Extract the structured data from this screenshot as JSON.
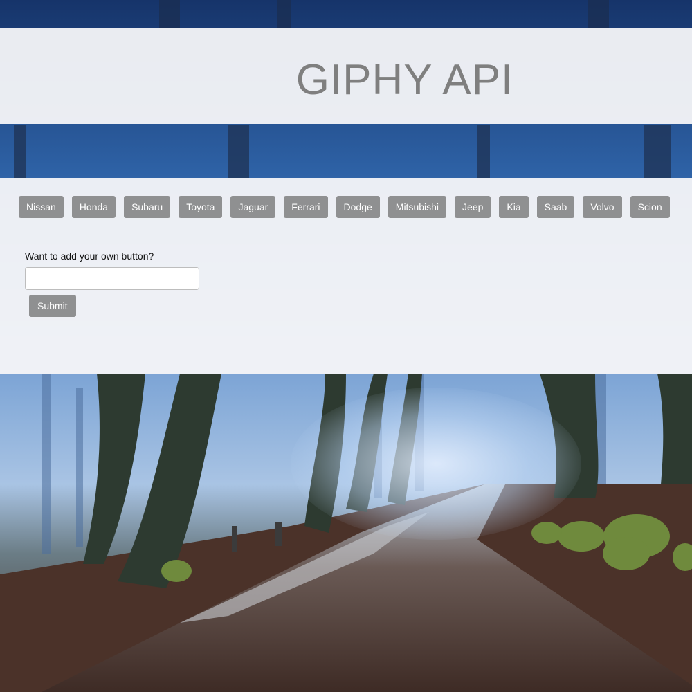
{
  "header": {
    "title": "GIPHY API"
  },
  "buttons": [
    {
      "label": "Nissan"
    },
    {
      "label": "Honda"
    },
    {
      "label": "Subaru"
    },
    {
      "label": "Toyota"
    },
    {
      "label": "Jaguar"
    },
    {
      "label": "Ferrari"
    },
    {
      "label": "Dodge"
    },
    {
      "label": "Mitsubishi"
    },
    {
      "label": "Jeep"
    },
    {
      "label": "Kia"
    },
    {
      "label": "Saab"
    },
    {
      "label": "Volvo"
    },
    {
      "label": "Scion"
    }
  ],
  "form": {
    "label": "Want to add your own button?",
    "input_value": "",
    "input_placeholder": "",
    "submit_label": "Submit"
  },
  "colors": {
    "button_bg": "#8f9091",
    "button_text": "#ffffff",
    "title_text": "#7f7f7f",
    "panel_bg": "#f5f6f8"
  }
}
